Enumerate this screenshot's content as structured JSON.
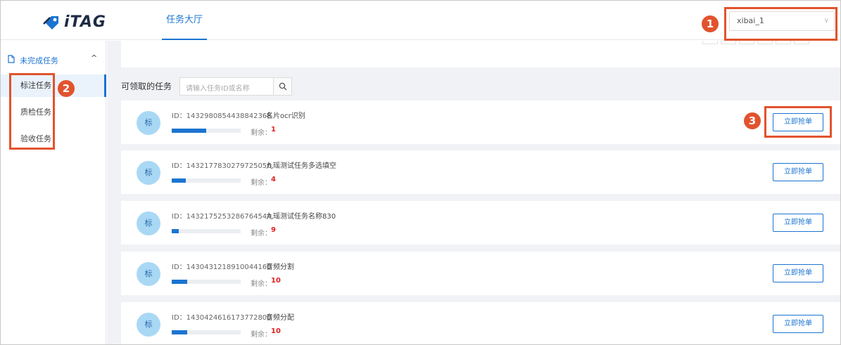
{
  "header": {
    "logo_text": "iTAG",
    "nav_tab": "任务大厅",
    "user": "xibai_1"
  },
  "sidebar": {
    "group_label": "未完成任务",
    "items": [
      {
        "label": "标注任务",
        "active": true
      },
      {
        "label": "质检任务",
        "active": false
      },
      {
        "label": "验收任务",
        "active": false
      }
    ]
  },
  "main": {
    "section_title": "可领取的任务",
    "search_placeholder": "请输入任务ID或名称",
    "tasks": [
      {
        "avatar": "标",
        "id": "ID：1432980854438842368",
        "name": "名片ocr识别",
        "remain_label": "剩余：",
        "remain": "1",
        "progress": 0.5,
        "button": "立即抢单"
      },
      {
        "avatar": "标",
        "id": "ID：1432177830279725056",
        "name": "九瑶测试任务多选填空",
        "remain_label": "剩余：",
        "remain": "4",
        "progress": 0.2,
        "button": "立即抢单"
      },
      {
        "avatar": "标",
        "id": "ID：1432175253286764544",
        "name": "九瑶测试任务名称830",
        "remain_label": "剩余：",
        "remain": "9",
        "progress": 0.1,
        "button": "立即抢单"
      },
      {
        "avatar": "标",
        "id": "ID：1430431218910044160",
        "name": "音频分割",
        "remain_label": "剩余：",
        "remain": "10",
        "progress": 0.22,
        "button": "立即抢单"
      },
      {
        "avatar": "标",
        "id": "ID：1430424616173772800",
        "name": "音频分配",
        "remain_label": "剩余：",
        "remain": "10",
        "progress": 0.22,
        "button": "立即抢单"
      }
    ]
  },
  "annotations": [
    "1",
    "2",
    "3"
  ],
  "colors": {
    "accent": "#1b74d1",
    "annotation": "#e2532d",
    "remain": "#e02020"
  }
}
